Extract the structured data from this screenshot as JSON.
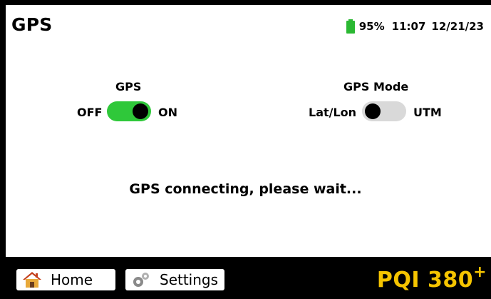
{
  "header": {
    "title": "GPS"
  },
  "status": {
    "battery_percent": "95%",
    "time": "11:07",
    "date": "12/21/23",
    "battery_color": "#2ab832"
  },
  "gps_setting": {
    "label": "GPS",
    "off_label": "OFF",
    "on_label": "ON",
    "state": "on"
  },
  "gps_mode_setting": {
    "label": "GPS Mode",
    "left_label": "Lat/Lon",
    "right_label": "UTM",
    "state": "Lat/Lon"
  },
  "message": "GPS connecting, please wait...",
  "footer": {
    "home_label": "Home",
    "home_icon": "home-icon",
    "settings_label": "Settings",
    "settings_icon": "gears-icon",
    "brand": "PQI 380",
    "brand_sup": "+",
    "brand_color": "#f5c400"
  },
  "colors": {
    "toggle_on": "#2fc83a",
    "toggle_off": "#d9d9d9"
  }
}
